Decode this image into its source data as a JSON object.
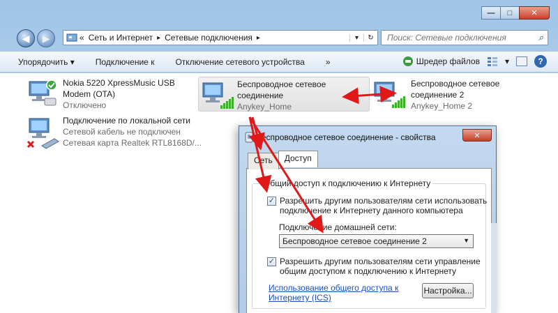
{
  "window": {
    "minimize_label": "—",
    "maximize_label": "□",
    "close_label": "✕"
  },
  "address_bar": {
    "overflow": "«",
    "crumbs": [
      "Сеть и Интернет",
      "Сетевые подключения"
    ],
    "separator": "▸",
    "dropdown": "▾",
    "refresh": "↻"
  },
  "search": {
    "placeholder": "Поиск: Сетевые подключения"
  },
  "toolbar": {
    "organize": "Упорядочить ▾",
    "connect": "Подключение к",
    "disconnect": "Отключение сетевого устройства",
    "more": "»",
    "shredder": "Шредер файлов",
    "view_dropdown": "▾",
    "help": "?"
  },
  "connections": [
    {
      "name": "Nokia 5220 XpressMusic USB",
      "name2": "Modem (OTA)",
      "status": "Отключено"
    },
    {
      "name": "Беспроводное сетевое",
      "name2": "соединение",
      "status": "Anykey_Home"
    },
    {
      "name": "Беспроводное сетевое",
      "name2": "соединение 2",
      "status": "Anykey_Home 2"
    },
    {
      "name": "Подключение по локальной сети",
      "name2": "Сетевой кабель не подключен",
      "status": "Сетевая карта Realtek RTL8168D/..."
    }
  ],
  "dialog": {
    "title": "Беспроводное сетевое соединение - свойства",
    "tabs": [
      "Сеть",
      "Доступ"
    ],
    "group_label": "Общий доступ к подключению к Интернету",
    "check1_line1": "Разрешить другим пользователям сети использовать",
    "check1_line2": "подключение к Интернету данного компьютера",
    "home_label": "Подключение домашней сети:",
    "home_value": "Беспроводное сетевое соединение 2",
    "check2_line1": "Разрешить другим пользователям сети управление",
    "check2_line2": "общим доступом к подключению к Интернету",
    "link_line1": "Использование общего доступа к",
    "link_line2": "Интернету (ICS)",
    "settings_button": "Настройка...",
    "check_mark": "✓"
  },
  "colors": {
    "accent": "#2f68b2",
    "annotation_arrow": "#e01818",
    "signal_green": "#3fae2a",
    "error_red": "#d21f1f"
  }
}
